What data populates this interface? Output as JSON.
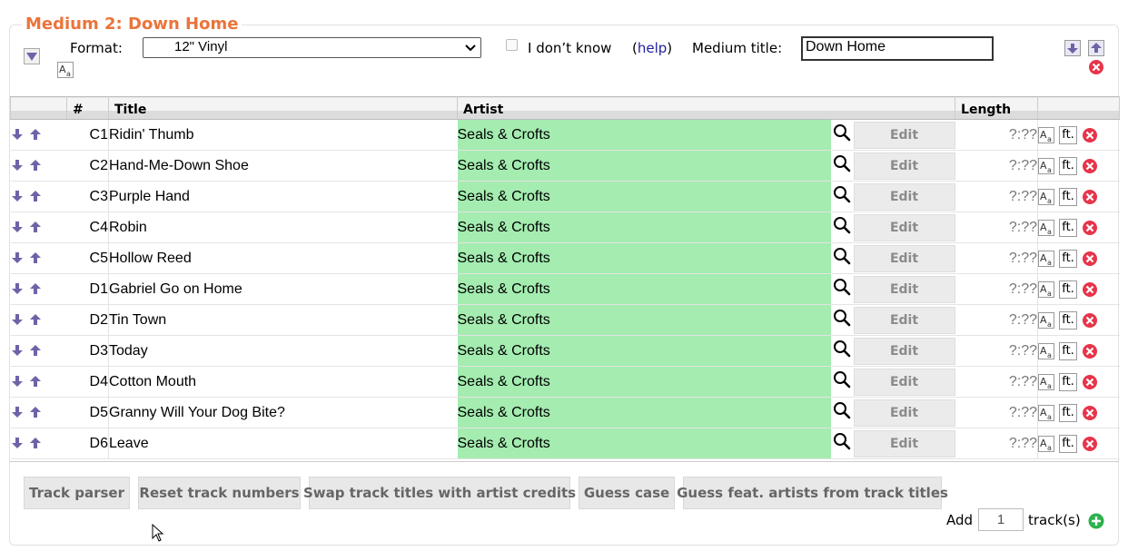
{
  "medium": {
    "legend": "Medium 2: Down Home",
    "format_label": "Format:",
    "format_value": "12\" Vinyl",
    "idk_label": "I don’t know",
    "help_open": "(",
    "help_link": "help",
    "help_close": ")",
    "title_label": "Medium title:",
    "title_value": "Down Home"
  },
  "table": {
    "headers": {
      "num": "#",
      "title": "Title",
      "artist": "Artist",
      "length": "Length"
    },
    "edit_label": "Edit",
    "ft_label": "ft.",
    "rows": [
      {
        "num": "C1",
        "title": "Ridin' Thumb",
        "artist": "Seals & Crofts",
        "length": "?:??"
      },
      {
        "num": "C2",
        "title": "Hand-Me-Down Shoe",
        "artist": "Seals & Crofts",
        "length": "?:??"
      },
      {
        "num": "C3",
        "title": "Purple Hand",
        "artist": "Seals & Crofts",
        "length": "?:??"
      },
      {
        "num": "C4",
        "title": "Robin",
        "artist": "Seals & Crofts",
        "length": "?:??"
      },
      {
        "num": "C5",
        "title": "Hollow Reed",
        "artist": "Seals & Crofts",
        "length": "?:??"
      },
      {
        "num": "D1",
        "title": "Gabriel Go on Home",
        "artist": "Seals & Crofts",
        "length": "?:??"
      },
      {
        "num": "D2",
        "title": "Tin Town",
        "artist": "Seals & Crofts",
        "length": "?:??"
      },
      {
        "num": "D3",
        "title": "Today",
        "artist": "Seals & Crofts",
        "length": "?:??"
      },
      {
        "num": "D4",
        "title": "Cotton Mouth",
        "artist": "Seals & Crofts",
        "length": "?:??"
      },
      {
        "num": "D5",
        "title": "Granny Will Your Dog Bite?",
        "artist": "Seals & Crofts",
        "length": "?:??"
      },
      {
        "num": "D6",
        "title": "Leave",
        "artist": "Seals & Crofts",
        "length": "?:??"
      }
    ]
  },
  "buttons": {
    "track_parser": "Track parser",
    "reset_numbers": "Reset track numbers",
    "swap_titles": "Swap track titles with artist credits",
    "guess_case": "Guess case",
    "guess_feat": "Guess feat. artists from track titles"
  },
  "add": {
    "label": "Add",
    "count": "1",
    "suffix": "track(s)"
  },
  "icons": {
    "collapse": "triangle-down-icon",
    "guess_case": "case-icon",
    "move_down": "arrow-down-icon",
    "move_up": "arrow-up-icon",
    "remove": "remove-icon",
    "search": "search-icon",
    "add": "add-icon",
    "cursor": "mouse-cursor-icon"
  },
  "colors": {
    "legend": "#eb743b",
    "artist_bg": "#a4ecb0",
    "arrow": "#6e63a8",
    "remove": "#e8344a",
    "add": "#2bb24c",
    "link": "#1f1fa0"
  }
}
